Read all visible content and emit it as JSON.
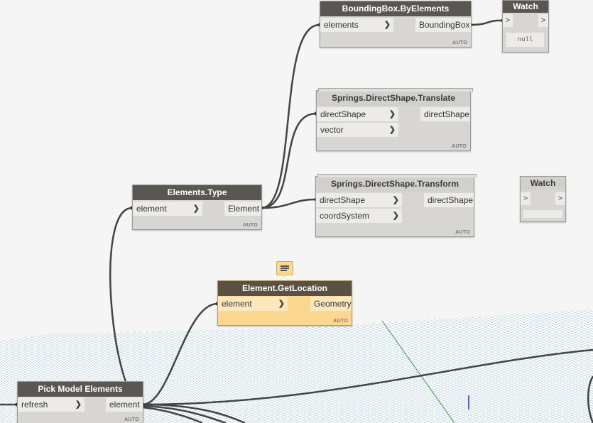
{
  "canvas": {
    "background": "#f5f5f5"
  },
  "nodes": {
    "bbox": {
      "title": "BoundingBox.ByElements",
      "input": "elements",
      "output": "BoundingBox",
      "lacing": "AUTO"
    },
    "watch1": {
      "title": "Watch",
      "in_symbol": ">",
      "out_symbol": ">",
      "value": "null"
    },
    "translate": {
      "title": "Springs.DirectShape.Translate",
      "inputs": [
        "directShape",
        "vector"
      ],
      "output": "directShape",
      "lacing": "AUTO"
    },
    "transform": {
      "title": "Springs.DirectShape.Transform",
      "inputs": [
        "directShape",
        "coordSystem"
      ],
      "output": "directShape",
      "lacing": "AUTO"
    },
    "watch2": {
      "title": "Watch",
      "in_symbol": ">",
      "out_symbol": ">",
      "value": ""
    },
    "elemtype": {
      "title": "Elements.Type",
      "input": "element",
      "output": "Element",
      "lacing": "AUTO"
    },
    "getloc": {
      "title": "Element.GetLocation",
      "input": "element",
      "output": "Geometry",
      "lacing": "AUTO"
    },
    "pick": {
      "title": "Pick Model Elements",
      "input": "refresh",
      "output": "element",
      "lacing": "AUTO"
    }
  },
  "icons": {
    "chevron": "chevron-right-icon",
    "note": "note-icon"
  },
  "colors": {
    "node_header": "#5a5652",
    "node_body": "#d8d6d2",
    "selected_body": "#fbd78f",
    "wire": "#444444"
  }
}
